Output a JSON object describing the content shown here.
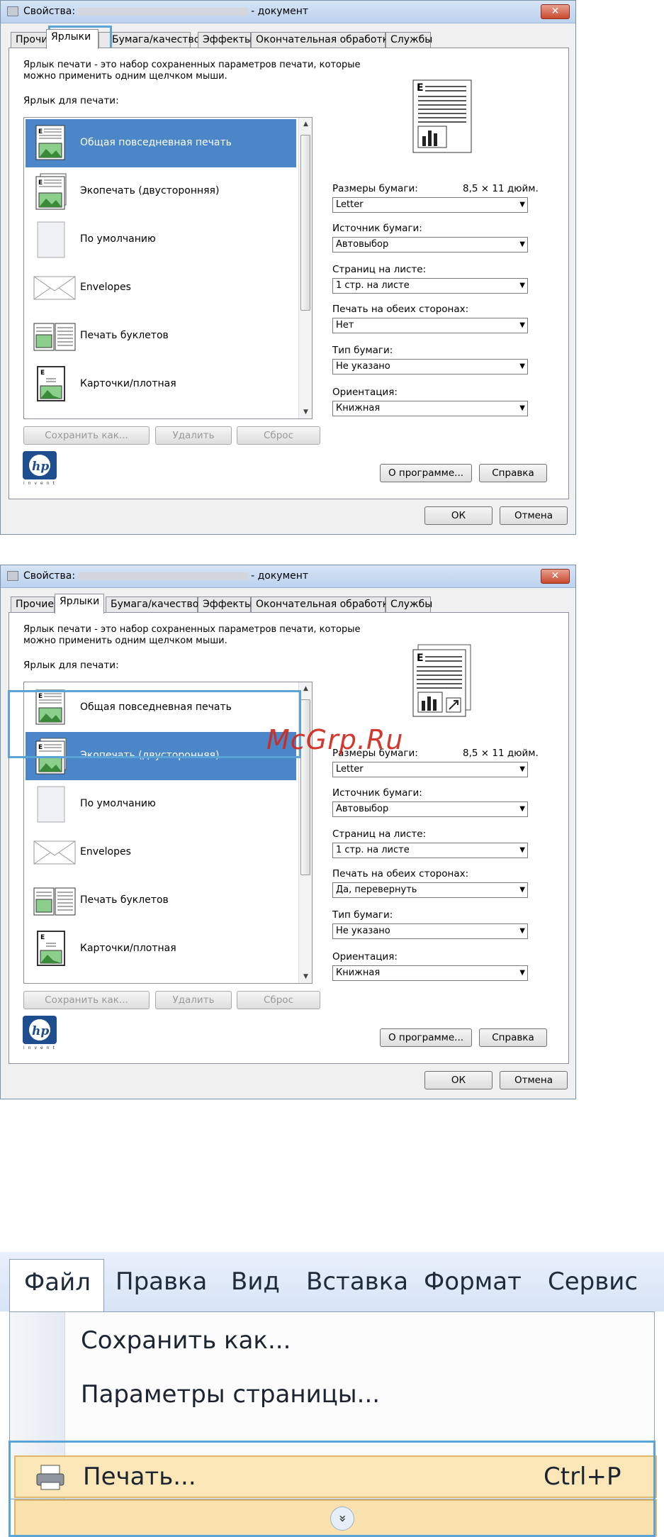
{
  "dialog": {
    "title_prefix": "Свойства:",
    "title_suffix": "- документ",
    "close": "✕",
    "tabs": [
      "Прочие",
      "Ярлыки",
      "Бумага/качество",
      "Эффекты",
      "Окончательная обработка",
      "Службы"
    ],
    "intro": "Ярлык печати - это набор сохраненных параметров печати, которые можно применить одним щелчком мыши.",
    "list_label": "Ярлык для печати:",
    "items": [
      "Общая повседневная печать",
      "Экопечать (двусторонняя)",
      "По умолчанию",
      "Envelopes",
      "Печать буклетов",
      "Карточки/плотная"
    ],
    "buttons": {
      "save_as": "Сохранить как...",
      "delete": "Удалить",
      "reset": "Сброс",
      "about": "О программе...",
      "help": "Справка",
      "ok": "ОК",
      "cancel": "Отмена"
    },
    "paper_size_label": "Размеры бумаги:",
    "paper_size_value": "8,5 × 11 дюйм.",
    "paper_size": "Letter",
    "source_label": "Источник бумаги:",
    "source": "Автовыбор",
    "pages_label": "Страниц на листе:",
    "pages": "1 стр. на листе",
    "duplex_label": "Печать на обеих сторонах:",
    "type_label": "Тип бумаги:",
    "type": "Не указано",
    "orient_label": "Ориентация:",
    "orient": "Книжная",
    "hp_invent": "invent"
  },
  "dialog1": {
    "selected_tab": "Ярлыки",
    "selected_item": "Общая повседневная печать",
    "duplex": "Нет"
  },
  "dialog2": {
    "selected_tab": "Ярлыки",
    "selected_item": "Экопечать (двусторонняя)",
    "duplex": "Да, перевернуть"
  },
  "watermark": "McGrp.Ru",
  "menu": {
    "bar": [
      "Файл",
      "Правка",
      "Вид",
      "Вставка",
      "Формат",
      "Сервис"
    ],
    "items": {
      "save_as": "Сохранить как...",
      "page_setup": "Параметры страницы...",
      "print": "Печать...",
      "print_shortcut": "Ctrl+P"
    }
  },
  "colors": {
    "selection": "#4a86c8",
    "highlight": "#5aa4d8",
    "menu_hover": "#fbe6b7"
  }
}
